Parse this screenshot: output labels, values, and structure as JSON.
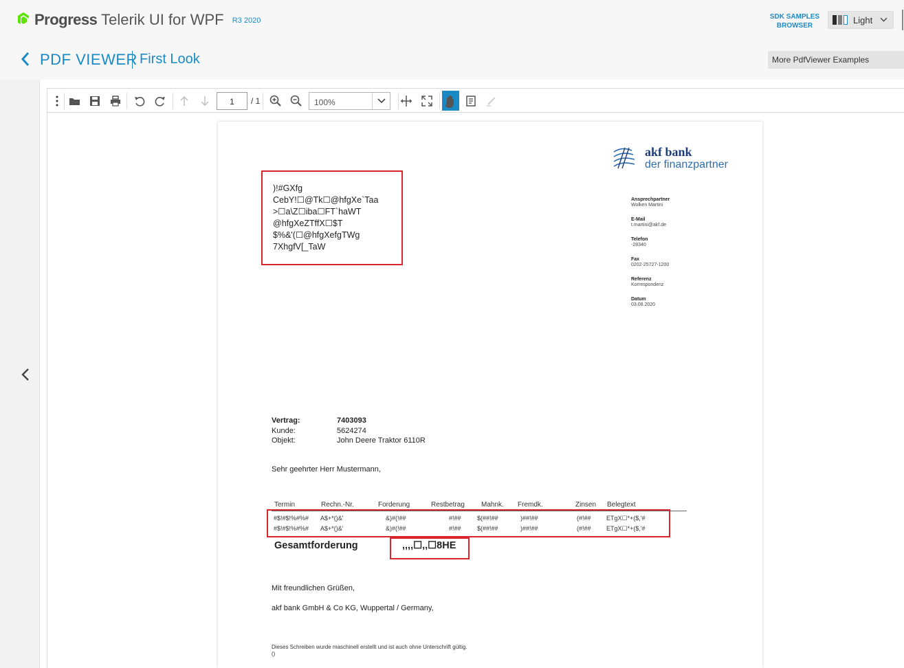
{
  "header": {
    "brand_company": "Progress",
    "brand_product_a": "Telerik",
    "brand_product_b": "UI for WPF",
    "release": "R3 2020",
    "sdk_browser_line1": "SDK SAMPLES",
    "sdk_browser_line2": "BROWSER",
    "theme": "Light",
    "accent_color": "#1a8ac6"
  },
  "titlebar": {
    "title": "PDF VIEWER",
    "subtitle": "First Look",
    "more_examples": "More PdfViewer Examples"
  },
  "toolbar": {
    "page_current": "1",
    "page_total": "/ 1",
    "zoom": "100%",
    "icons": [
      "more-vertical-icon",
      "open-folder-icon",
      "save-icon",
      "print-icon",
      "rotate-left-icon",
      "rotate-right-icon",
      "previous-page-icon",
      "next-page-icon",
      "zoom-in-icon",
      "zoom-out-icon",
      "fit-width-icon",
      "fit-page-icon",
      "pan-hand-icon",
      "text-selection-icon",
      "signature-icon"
    ]
  },
  "document": {
    "bank_name": "akf bank",
    "bank_tagline": "der finanzpartner",
    "contact": [
      {
        "label": "Ansprechpartner",
        "value": "Wolken Martini"
      },
      {
        "label": "E-Mail",
        "value": "t.martini@akf.de"
      },
      {
        "label": "Telefon",
        "value": "-28340"
      },
      {
        "label": "Fax",
        "value": "0202-25727-1200"
      },
      {
        "label": "Referenz",
        "value": "Korrespondenz"
      },
      {
        "label": "Datum",
        "value": "03.08.2020"
      }
    ],
    "address_lines": [
      ")!#GXfg",
      "CebY!☐@Tk☐@hfgXe`Taa",
      ">☐a\\Z☐iba☐FT`haWT",
      "@hfgXeZTffX☐$T",
      "$%&'(☐@hfgXefgTWg",
      "7XhgfV[_TaW"
    ],
    "contract": {
      "vertrag_label": "Vertrag:",
      "vertrag_value": "7403093",
      "kunde_label": "Kunde:",
      "kunde_value": "5624274",
      "objekt_label": "Objekt:",
      "objekt_value": "John Deere Traktor 6110R"
    },
    "salutation": "Sehr geehrter Herr Mustermann,",
    "table": {
      "headers": [
        "Termin",
        "Rechn.-Nr.",
        "Forderung",
        "Restbetrag",
        "Mahnk.",
        "Fremdk.",
        "Zinsen",
        "Belegtext"
      ],
      "rows": [
        [
          "#$!#$!%#%#",
          "A$+*()&'",
          "&)#(!##",
          "#!##",
          "$(##!##",
          ")##!##",
          "(#!##",
          "ETgX☐*+($,'#"
        ],
        [
          "#$!#$!%#%#",
          "A$+*()&'",
          "&)#(!##",
          "#!##",
          "$(##!##",
          ")##!##",
          "(#!##",
          "ETgX☐*+($,'#"
        ]
      ]
    },
    "total_label": "Gesamtforderung",
    "total_value": ",,,,☐,,☐8HE",
    "closing": "Mit freundlichen Grüßen,",
    "company": "akf bank GmbH & Co KG, Wuppertal / Germany,",
    "footnote_line1": "Dieses Schreiben wurde maschinell erstellt und ist auch ohne Unterschrift gültig.",
    "footnote_line2": "()",
    "highlight_color": "#d9232d"
  }
}
